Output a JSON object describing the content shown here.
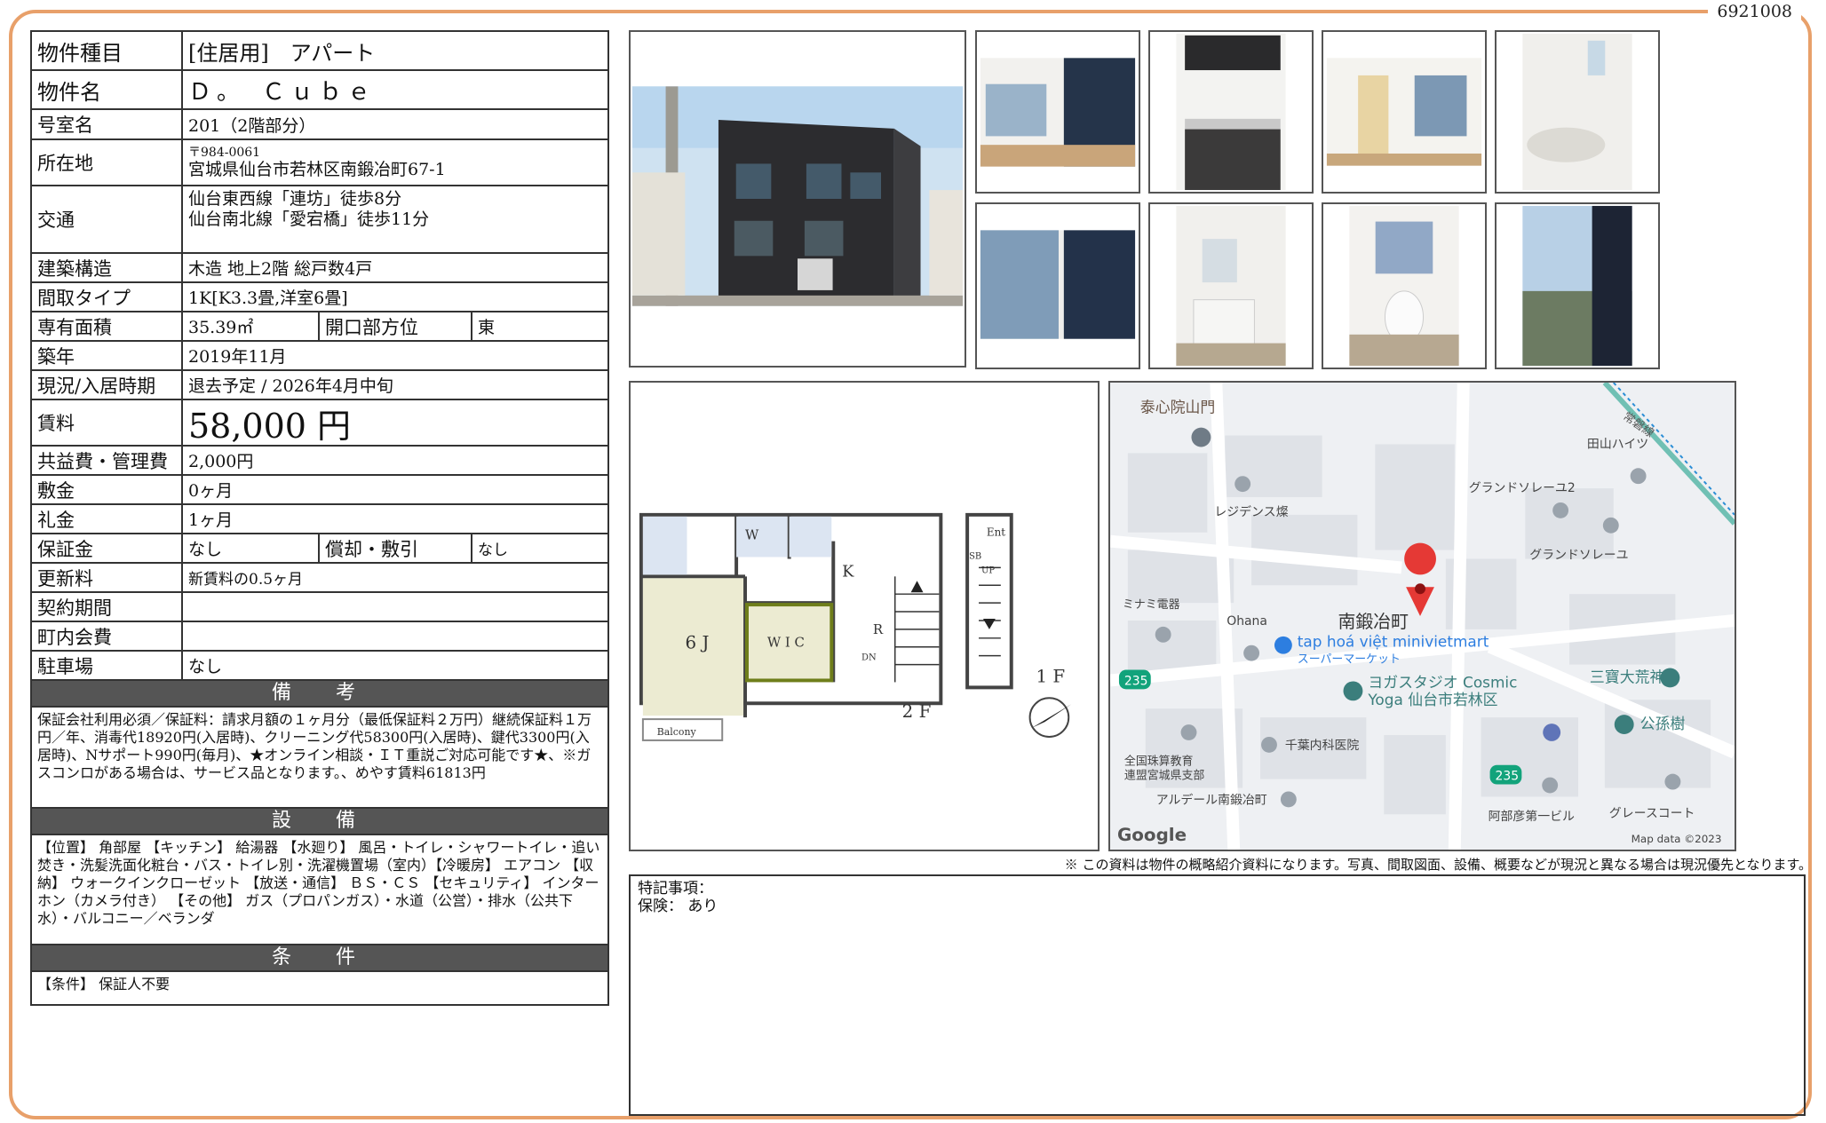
{
  "doc_id": "6921008",
  "info": {
    "rows": [
      {
        "label": "物件種目",
        "value": "[住居用]　アパート"
      },
      {
        "label": "物件名",
        "value": "Ｄ。　Ｃｕｂｅ"
      },
      {
        "label": "号室名",
        "value": "201（2階部分）"
      },
      {
        "label": "所在地",
        "postal": "〒984-0061",
        "value": "宮城県仙台市若林区南鍛冶町67-1"
      },
      {
        "label": "交通",
        "line1": "仙台東西線「連坊」徒歩8分",
        "line2": "仙台南北線「愛宕橋」徒歩11分"
      },
      {
        "label": "建築構造",
        "value": "木造 地上2階 総戸数4戸"
      },
      {
        "label": "間取タイプ",
        "value": "1K[K3.3畳,洋室6畳]"
      },
      {
        "label": "専有面積",
        "value": "35.39㎡",
        "label2": "開口部方位",
        "value2": "東"
      },
      {
        "label": "築年",
        "value": "2019年11月"
      },
      {
        "label": "現況/入居時期",
        "value": "退去予定 / 2026年4月中旬"
      },
      {
        "label": "賃料",
        "value": "58,000 円"
      },
      {
        "label": "共益費・管理費",
        "value": "2,000円"
      },
      {
        "label": "敷金",
        "value": "0ヶ月"
      },
      {
        "label": "礼金",
        "value": "1ヶ月"
      },
      {
        "label": "保証金",
        "value": "なし",
        "label2": "償却・敷引",
        "value2": "なし"
      },
      {
        "label": "更新料",
        "value": "新賃料の0.5ヶ月"
      },
      {
        "label": "契約期間",
        "value": ""
      },
      {
        "label": "町内会費",
        "value": ""
      },
      {
        "label": "駐車場",
        "value": "なし"
      }
    ],
    "remarks_title": "備　考",
    "remarks": "保証会社利用必須／保証料：請求月額の１ヶ月分（最低保証料２万円）継続保証料１万円／年、消毒代18920円(入居時)、クリーニング代58300円(入居時)、鍵代3300円(入居時)、Nサポート990円(毎月)、★オンライン相談・ＩＴ重説ご対応可能です★、※ガスコンロがある場合は、サービス品となります。、めやす賃料61813円",
    "equipment_title": "設　備",
    "equipment": "【位置】 角部屋 【キッチン】 給湯器 【水廻り】 風呂・トイレ・シャワートイレ・追い焚き・洗髪洗面化粧台・バス・トイレ別・洗濯機置場（室内）【冷暖房】 エアコン 【収納】 ウォークインクローゼット 【放送・通信】 ＢＳ・ＣＳ 【セキュリティ】 インターホン（カメラ付き） 【その他】 ガス（プロパンガス）・水道（公営）・排水（公共下水）・バルコニー／ベランダ",
    "conditions_title": "条　件",
    "conditions": "【条件】 保証人不要"
  },
  "floorplan": {
    "labels": {
      "w": "W",
      "k": "K",
      "r": "R",
      "dn": "DN",
      "room6": "6 J",
      "wic": "W I C",
      "balcony": "Balcony",
      "ent": "Ent",
      "sb": "SB",
      "up": "UP",
      "f1": "1 F",
      "f2": "2 F"
    }
  },
  "map": {
    "labels": {
      "temple": "泰心院山門",
      "residence": "レジデンス燦",
      "minami": "ミナミ電器",
      "ohana": "Ohana",
      "station_area": "南鍛冶町",
      "market": "tap hoá việt minivietmart",
      "market_sub": "スーパーマーケット",
      "yoga1": "ヨガスタジオ Cosmic",
      "yoga2": "Yoga 仙台市若林区",
      "grand2": "グランドソレーユ2",
      "grand": "グランドソレーユ",
      "tayama": "田山ハイツ",
      "sanpou": "三寶大荒神",
      "kosonju": "公孫樹",
      "chiba": "千葉内科医院",
      "zenkoku1": "全国珠算教育",
      "zenkoku2": "連盟宮城県支部",
      "ardeal": "アルデール南鍛冶町",
      "abe": "阿部彦第一ビル",
      "grace": "グレースコート",
      "route": "235",
      "route2": "235",
      "railway": "常磐線",
      "google": "Google",
      "mapdata": "Map data ©2023"
    }
  },
  "disclaimer": "※ この資料は物件の概略紹介資料になります。写真、間取図面、設備、概要などが現況と異なる場合は現況優先となります。",
  "notes": {
    "title": "特記事項：",
    "insurance": "保険： あり"
  }
}
